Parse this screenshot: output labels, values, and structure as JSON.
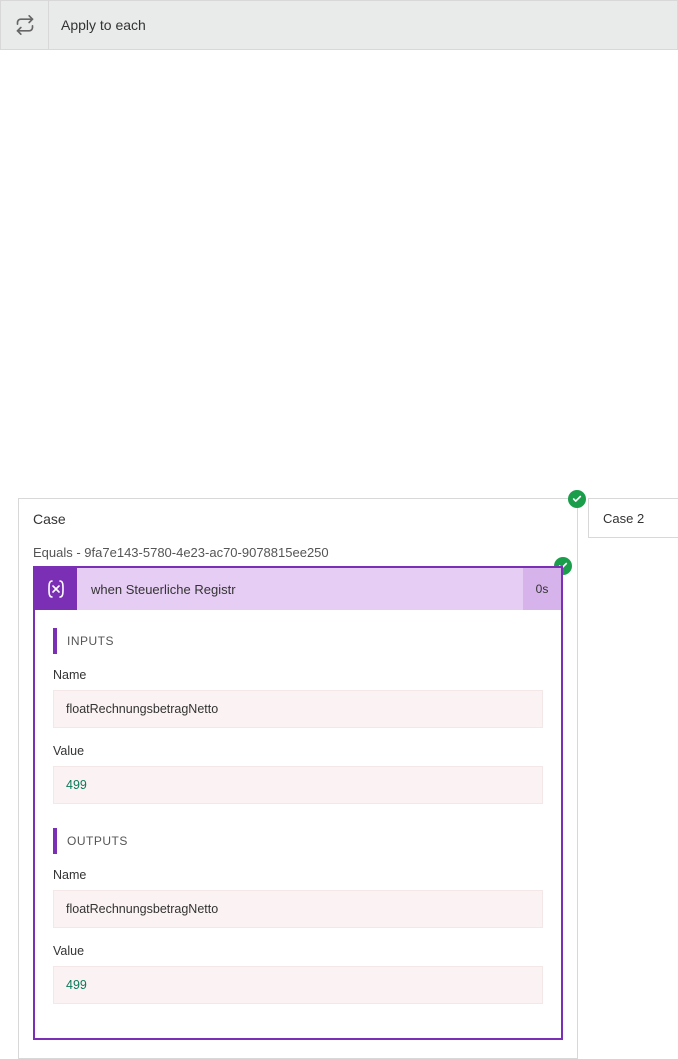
{
  "top": {
    "title": "Apply to each"
  },
  "case1": {
    "title": "Case",
    "condition": "Equals - 9fa7e143-5780-4e23-ac70-9078815ee250",
    "action": {
      "title": "when Steuerliche Registr",
      "duration": "0s",
      "inputs": {
        "heading": "INPUTS",
        "name_label": "Name",
        "name_value": "floatRechnungsbetragNetto",
        "value_label": "Value",
        "value_value": "499"
      },
      "outputs": {
        "heading": "OUTPUTS",
        "name_label": "Name",
        "name_value": "floatRechnungsbetragNetto",
        "value_label": "Value",
        "value_value": "499"
      }
    }
  },
  "case2": {
    "title": "Case 2"
  }
}
